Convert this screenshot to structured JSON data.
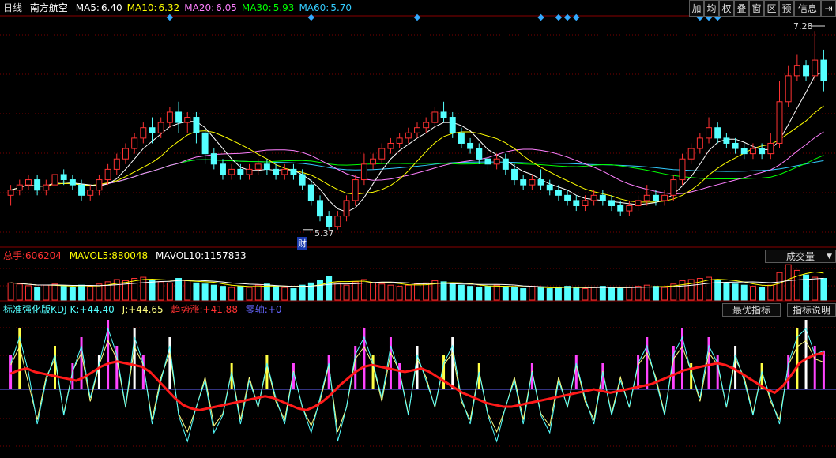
{
  "header": {
    "period": "日线",
    "stock_name": "南方航空",
    "ma": [
      {
        "label": "MA5:",
        "value": "6.40",
        "color": "#ffffff"
      },
      {
        "label": "MA10:",
        "value": "6.32",
        "color": "#ffff00"
      },
      {
        "label": "MA20:",
        "value": "6.05",
        "color": "#ff80ff"
      },
      {
        "label": "MA30:",
        "value": "5.93",
        "color": "#00ff00"
      },
      {
        "label": "MA60:",
        "value": "5.70",
        "color": "#33ccff"
      }
    ]
  },
  "toolbar": [
    {
      "label": "加",
      "name": "add-button"
    },
    {
      "label": "均",
      "name": "average-button"
    },
    {
      "label": "权",
      "name": "rights-button"
    },
    {
      "label": "叠",
      "name": "overlay-button"
    },
    {
      "label": "窗",
      "name": "window-button"
    },
    {
      "label": "区",
      "name": "range-button"
    },
    {
      "label": "预",
      "name": "forecast-button"
    },
    {
      "label": "信息",
      "name": "info-button"
    }
  ],
  "price_annotations": {
    "high": "7.28",
    "low": "5.37",
    "event_marker": "财"
  },
  "volume_header": {
    "total_label": "总手:",
    "total_value": "606204",
    "mavol5_label": "MAVOL5:",
    "mavol5_value": "880048",
    "mavol10_label": "MAVOL10:",
    "mavol10_value": "1157833",
    "selector": "成交量"
  },
  "kdj_header": {
    "name": "标准强化版KDJ",
    "k_label": "K:",
    "k_value": "+44.40",
    "j_label": "J:",
    "j_value": "+44.65",
    "trend_label": "趋势涨:",
    "trend_value": "+41.88",
    "zero_label": "零轴:",
    "zero_value": "+0",
    "best_button": "最优指标",
    "explain_button": "指标说明"
  },
  "colors": {
    "up": "#ff3232",
    "down": "#54ffff",
    "ma5": "#ffffff",
    "ma10": "#ffff00",
    "ma20": "#ff80ff",
    "ma30": "#00ff00",
    "ma60": "#33ccff",
    "grid": "#7a0000",
    "trend": "#ff1a1a",
    "zero": "#6666ff",
    "k": "#54ffff",
    "j": "#ffff80"
  },
  "chart_data": {
    "type": "candlestick",
    "ylim": [
      5.3,
      7.35
    ],
    "price_candles": [
      [
        5.7,
        5.75,
        5.6,
        5.8
      ],
      [
        5.75,
        5.8,
        5.7,
        5.85
      ],
      [
        5.8,
        5.85,
        5.75,
        5.9
      ],
      [
        5.85,
        5.75,
        5.7,
        5.9
      ],
      [
        5.75,
        5.8,
        5.7,
        5.85
      ],
      [
        5.8,
        5.9,
        5.75,
        5.95
      ],
      [
        5.9,
        5.85,
        5.8,
        5.95
      ],
      [
        5.85,
        5.8,
        5.75,
        5.9
      ],
      [
        5.8,
        5.7,
        5.65,
        5.85
      ],
      [
        5.7,
        5.75,
        5.65,
        5.8
      ],
      [
        5.75,
        5.85,
        5.7,
        5.9
      ],
      [
        5.85,
        5.95,
        5.8,
        6.0
      ],
      [
        5.95,
        6.05,
        5.9,
        6.1
      ],
      [
        6.05,
        6.15,
        6.0,
        6.2
      ],
      [
        6.15,
        6.25,
        6.1,
        6.3
      ],
      [
        6.25,
        6.35,
        6.2,
        6.4
      ],
      [
        6.35,
        6.3,
        6.2,
        6.45
      ],
      [
        6.3,
        6.4,
        6.25,
        6.45
      ],
      [
        6.4,
        6.5,
        6.35,
        6.55
      ],
      [
        6.5,
        6.4,
        6.3,
        6.6
      ],
      [
        6.4,
        6.45,
        6.3,
        6.5
      ],
      [
        6.45,
        6.3,
        6.2,
        6.5
      ],
      [
        6.3,
        6.1,
        6.0,
        6.35
      ],
      [
        6.1,
        6.0,
        5.95,
        6.15
      ],
      [
        6.0,
        5.9,
        5.85,
        6.05
      ],
      [
        5.9,
        5.95,
        5.85,
        6.0
      ],
      [
        5.95,
        5.9,
        5.85,
        6.0
      ],
      [
        5.9,
        5.95,
        5.85,
        6.0
      ],
      [
        5.95,
        6.0,
        5.9,
        6.05
      ],
      [
        6.0,
        5.95,
        5.9,
        6.05
      ],
      [
        5.95,
        5.9,
        5.85,
        6.0
      ],
      [
        5.9,
        5.95,
        5.85,
        6.0
      ],
      [
        5.95,
        5.9,
        5.85,
        6.0
      ],
      [
        5.9,
        5.8,
        5.75,
        5.95
      ],
      [
        5.8,
        5.65,
        5.6,
        5.85
      ],
      [
        5.65,
        5.5,
        5.45,
        5.7
      ],
      [
        5.5,
        5.4,
        5.37,
        5.55
      ],
      [
        5.4,
        5.5,
        5.37,
        5.55
      ],
      [
        5.5,
        5.65,
        5.45,
        5.7
      ],
      [
        5.65,
        5.85,
        5.6,
        5.9
      ],
      [
        5.85,
        6.0,
        5.8,
        6.1
      ],
      [
        6.0,
        6.05,
        5.95,
        6.1
      ],
      [
        6.05,
        6.15,
        6.0,
        6.2
      ],
      [
        6.15,
        6.2,
        6.1,
        6.25
      ],
      [
        6.2,
        6.25,
        6.15,
        6.3
      ],
      [
        6.25,
        6.3,
        6.2,
        6.35
      ],
      [
        6.3,
        6.35,
        6.25,
        6.4
      ],
      [
        6.35,
        6.4,
        6.3,
        6.45
      ],
      [
        6.4,
        6.5,
        6.35,
        6.55
      ],
      [
        6.5,
        6.45,
        6.4,
        6.6
      ],
      [
        6.45,
        6.3,
        6.25,
        6.5
      ],
      [
        6.3,
        6.2,
        6.15,
        6.35
      ],
      [
        6.2,
        6.15,
        6.1,
        6.25
      ],
      [
        6.15,
        6.05,
        6.0,
        6.2
      ],
      [
        6.05,
        6.0,
        5.95,
        6.1
      ],
      [
        6.0,
        6.05,
        5.95,
        6.1
      ],
      [
        6.05,
        5.95,
        5.9,
        6.1
      ],
      [
        5.95,
        5.85,
        5.8,
        6.0
      ],
      [
        5.85,
        5.8,
        5.75,
        5.9
      ],
      [
        5.8,
        5.85,
        5.75,
        5.9
      ],
      [
        5.85,
        5.8,
        5.75,
        5.95
      ],
      [
        5.8,
        5.75,
        5.7,
        5.85
      ],
      [
        5.75,
        5.7,
        5.65,
        5.8
      ],
      [
        5.7,
        5.65,
        5.6,
        5.75
      ],
      [
        5.65,
        5.6,
        5.55,
        5.7
      ],
      [
        5.6,
        5.65,
        5.55,
        5.7
      ],
      [
        5.65,
        5.7,
        5.6,
        5.75
      ],
      [
        5.7,
        5.65,
        5.6,
        5.75
      ],
      [
        5.65,
        5.6,
        5.55,
        5.7
      ],
      [
        5.6,
        5.55,
        5.5,
        5.65
      ],
      [
        5.55,
        5.6,
        5.5,
        5.65
      ],
      [
        5.6,
        5.65,
        5.55,
        5.7
      ],
      [
        5.65,
        5.7,
        5.6,
        5.8
      ],
      [
        5.7,
        5.65,
        5.6,
        5.75
      ],
      [
        5.65,
        5.7,
        5.6,
        5.75
      ],
      [
        5.7,
        5.85,
        5.65,
        5.9
      ],
      [
        5.85,
        6.05,
        5.8,
        6.1
      ],
      [
        6.05,
        6.15,
        6.0,
        6.2
      ],
      [
        6.15,
        6.25,
        6.1,
        6.3
      ],
      [
        6.25,
        6.35,
        6.2,
        6.45
      ],
      [
        6.35,
        6.25,
        6.2,
        6.4
      ],
      [
        6.25,
        6.2,
        6.15,
        6.3
      ],
      [
        6.2,
        6.15,
        6.1,
        6.25
      ],
      [
        6.15,
        6.1,
        6.05,
        6.2
      ],
      [
        6.1,
        6.15,
        6.05,
        6.2
      ],
      [
        6.15,
        6.1,
        6.05,
        6.2
      ],
      [
        6.1,
        6.2,
        6.05,
        6.3
      ],
      [
        6.2,
        6.6,
        6.15,
        6.8
      ],
      [
        6.6,
        6.85,
        6.55,
        6.95
      ],
      [
        6.85,
        6.95,
        6.8,
        7.05
      ],
      [
        6.95,
        6.85,
        6.8,
        7.0
      ],
      [
        6.85,
        7.0,
        6.8,
        7.28
      ],
      [
        7.0,
        6.8,
        6.7,
        7.1
      ]
    ],
    "volume": [
      30,
      28,
      25,
      22,
      26,
      28,
      24,
      22,
      26,
      24,
      28,
      32,
      36,
      34,
      38,
      40,
      35,
      32,
      30,
      38,
      34,
      30,
      28,
      26,
      24,
      22,
      24,
      22,
      26,
      28,
      24,
      22,
      20,
      26,
      30,
      34,
      42,
      30,
      26,
      32,
      36,
      30,
      28,
      26,
      24,
      26,
      28,
      30,
      34,
      32,
      28,
      26,
      24,
      22,
      24,
      26,
      24,
      22,
      20,
      24,
      22,
      20,
      22,
      24,
      22,
      20,
      22,
      24,
      22,
      20,
      22,
      24,
      26,
      24,
      22,
      28,
      34,
      36,
      38,
      40,
      34,
      30,
      28,
      26,
      24,
      22,
      26,
      48,
      62,
      52,
      44,
      40,
      38
    ],
    "kdj_trend": [
      18,
      22,
      24,
      20,
      18,
      16,
      14,
      12,
      10,
      14,
      20,
      26,
      30,
      32,
      30,
      28,
      26,
      20,
      10,
      0,
      -10,
      -18,
      -22,
      -24,
      -22,
      -20,
      -18,
      -16,
      -14,
      -12,
      -10,
      -8,
      -10,
      -14,
      -18,
      -22,
      -24,
      -20,
      -14,
      -6,
      4,
      12,
      20,
      26,
      28,
      26,
      24,
      22,
      20,
      22,
      24,
      20,
      14,
      8,
      2,
      -4,
      -8,
      -12,
      -16,
      -18,
      -20,
      -20,
      -18,
      -16,
      -14,
      -12,
      -10,
      -8,
      -6,
      -4,
      -2,
      0,
      -2,
      -4,
      -2,
      0,
      2,
      4,
      6,
      10,
      14,
      18,
      22,
      24,
      26,
      28,
      30,
      28,
      24,
      18,
      12,
      6,
      0,
      -4,
      4,
      16,
      30,
      36,
      40,
      41.88
    ],
    "kdj_k": [
      30,
      60,
      20,
      -40,
      10,
      40,
      -30,
      20,
      50,
      -10,
      30,
      70,
      40,
      -20,
      60,
      30,
      -40,
      10,
      50,
      -30,
      -60,
      -20,
      10,
      -50,
      -30,
      20,
      -40,
      10,
      -20,
      30,
      -10,
      -40,
      20,
      -20,
      -50,
      -10,
      30,
      -60,
      -20,
      40,
      60,
      30,
      -10,
      50,
      20,
      -30,
      40,
      10,
      -20,
      30,
      50,
      -10,
      -40,
      20,
      -30,
      -60,
      -20,
      10,
      -40,
      20,
      -30,
      -50,
      10,
      -20,
      30,
      -10,
      -40,
      20,
      -30,
      10,
      -20,
      30,
      50,
      10,
      -30,
      40,
      60,
      20,
      -10,
      50,
      30,
      -20,
      40,
      10,
      -30,
      20,
      -10,
      -40,
      30,
      60,
      70,
      40,
      44.4
    ],
    "kdj_j": [
      40,
      70,
      10,
      -50,
      20,
      50,
      -40,
      30,
      60,
      -20,
      40,
      80,
      50,
      -30,
      70,
      40,
      -50,
      20,
      60,
      -40,
      -70,
      -30,
      20,
      -60,
      -40,
      30,
      -50,
      20,
      -30,
      40,
      -20,
      -50,
      30,
      -30,
      -60,
      -20,
      40,
      -70,
      -30,
      50,
      70,
      40,
      -20,
      60,
      30,
      -40,
      50,
      20,
      -30,
      40,
      60,
      -20,
      -50,
      30,
      -40,
      -70,
      -30,
      20,
      -50,
      30,
      -40,
      -60,
      20,
      -30,
      40,
      -20,
      -50,
      30,
      -40,
      20,
      -30,
      40,
      60,
      20,
      -40,
      50,
      70,
      30,
      -20,
      60,
      40,
      -30,
      50,
      20,
      -40,
      30,
      -20,
      -50,
      40,
      70,
      80,
      50,
      44.65
    ]
  }
}
